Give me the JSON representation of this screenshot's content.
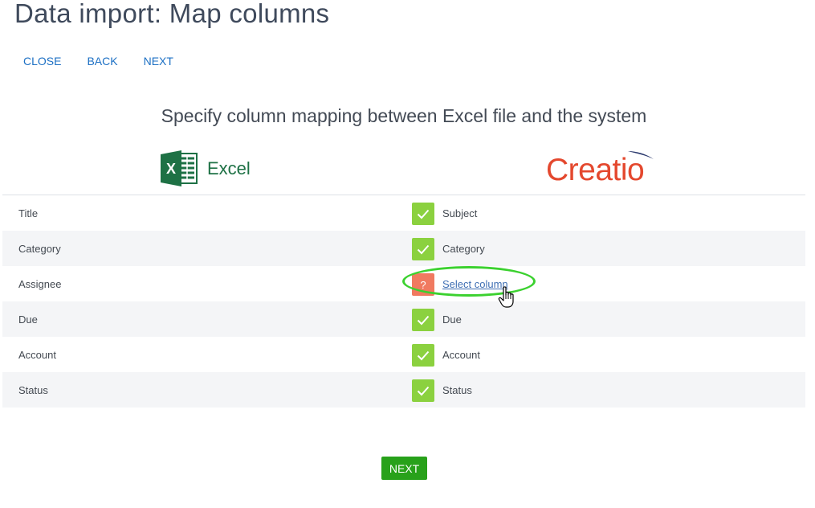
{
  "page": {
    "title": "Data import: Map columns",
    "subtitle": "Specify column mapping between Excel file and the system"
  },
  "toolbar": {
    "close_label": "CLOSE",
    "back_label": "BACK",
    "next_label": "NEXT"
  },
  "logos": {
    "excel_letter": "X",
    "excel_word": "Excel",
    "creatio_word": "Creatio"
  },
  "mapping": {
    "rows": [
      {
        "source": "Title",
        "target": "Subject",
        "status": "mapped",
        "status_icon": "check-icon"
      },
      {
        "source": "Category",
        "target": "Category",
        "status": "mapped",
        "status_icon": "check-icon"
      },
      {
        "source": "Assignee",
        "target": "Select column",
        "status": "unmapped",
        "status_glyph": "?",
        "status_icon": "question-icon"
      },
      {
        "source": "Due",
        "target": "Due",
        "status": "mapped",
        "status_icon": "check-icon"
      },
      {
        "source": "Account",
        "target": "Account",
        "status": "mapped",
        "status_icon": "check-icon"
      },
      {
        "source": "Status",
        "target": "Status",
        "status": "mapped",
        "status_icon": "check-icon"
      }
    ]
  },
  "footer": {
    "next_label": "NEXT"
  },
  "colors": {
    "link": "#1d70c4",
    "mapped": "#8bd13f",
    "unmapped": "#f07a60",
    "primary_button": "#28a11a",
    "highlight": "#3bd12f",
    "excel_green": "#1e7145",
    "creatio_red": "#e4482e"
  }
}
